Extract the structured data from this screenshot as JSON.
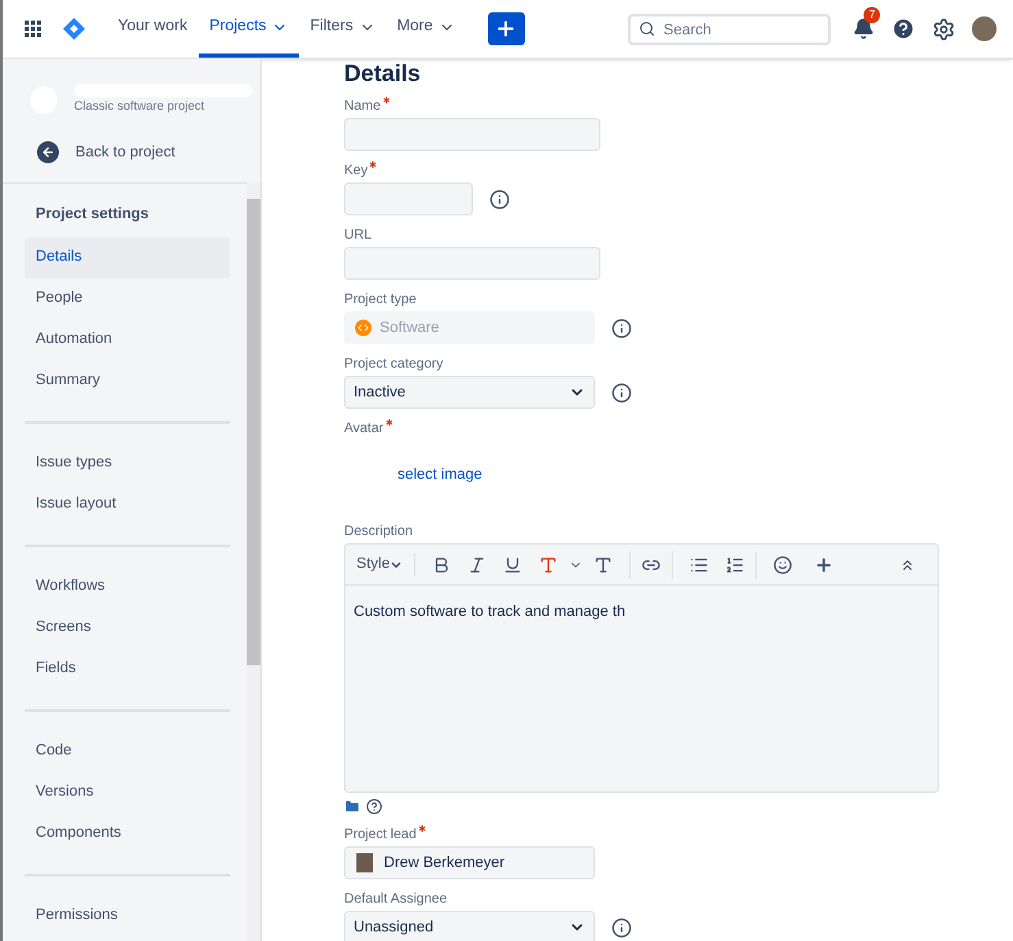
{
  "topnav": {
    "items": [
      {
        "label": "Your work",
        "selected": false,
        "dropdown": false
      },
      {
        "label": "Projects",
        "selected": true,
        "dropdown": true
      },
      {
        "label": "Filters",
        "selected": false,
        "dropdown": true
      },
      {
        "label": "More",
        "selected": false,
        "dropdown": true
      }
    ],
    "search": {
      "placeholder": "Search"
    },
    "notifications": "7"
  },
  "sidebar": {
    "project_type": "Classic software project",
    "back": "Back to project",
    "groups": [
      {
        "heading": "Project settings",
        "items": [
          {
            "label": "Details",
            "selected": true
          },
          {
            "label": "People",
            "selected": false
          },
          {
            "label": "Automation",
            "selected": false
          },
          {
            "label": "Summary",
            "selected": false
          }
        ]
      },
      {
        "items": [
          {
            "label": "Issue types",
            "selected": false
          },
          {
            "label": "Issue layout",
            "selected": false
          }
        ]
      },
      {
        "items": [
          {
            "label": "Workflows",
            "selected": false
          },
          {
            "label": "Screens",
            "selected": false
          },
          {
            "label": "Fields",
            "selected": false
          }
        ]
      },
      {
        "items": [
          {
            "label": "Code",
            "selected": false
          },
          {
            "label": "Versions",
            "selected": false
          },
          {
            "label": "Components",
            "selected": false
          }
        ]
      },
      {
        "items": [
          {
            "label": "Permissions",
            "selected": false
          }
        ]
      }
    ]
  },
  "main": {
    "title": "Details",
    "fields": [
      {
        "kind": "text",
        "label": "Name",
        "required": true
      },
      {
        "kind": "key",
        "label": "Key",
        "required": true,
        "info": true
      },
      {
        "kind": "text",
        "label": "URL"
      },
      {
        "kind": "type",
        "label": "Project type",
        "value": "Software",
        "info": true
      },
      {
        "kind": "select",
        "label": "Project category",
        "value": "Inactive",
        "info": true
      },
      {
        "kind": "avatar",
        "label": "Avatar",
        "required": true,
        "link": "select image"
      },
      {
        "kind": "editor",
        "label": "Description",
        "style": "Style",
        "value": "Custom software to track and manage th"
      },
      {
        "kind": "user",
        "label": "Project lead",
        "required": true,
        "value": "Drew Berkemeyer"
      },
      {
        "kind": "select",
        "label": "Default Assignee",
        "value": "Unassigned",
        "info": true
      }
    ]
  }
}
